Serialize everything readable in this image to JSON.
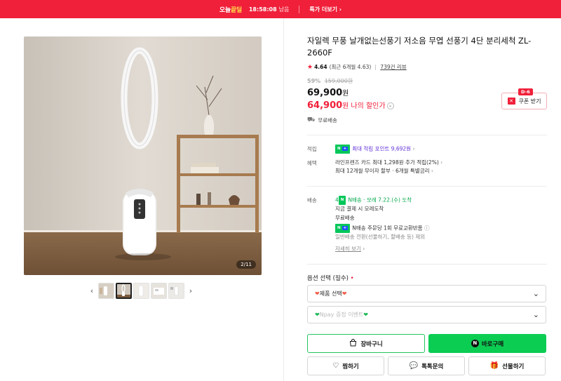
{
  "banner": {
    "brand_prefix": "오늘",
    "brand_suffix": "끝딜",
    "time": "18:58:08",
    "remain": "남음",
    "more": "특가 더보기"
  },
  "gallery": {
    "counter": "2/11",
    "thumb_count": 5,
    "active_thumb": 2
  },
  "product": {
    "title": "자일렉 무풍 날개없는선풍기 저소음 무엽 선풍기 4단 분리세척 ZL-2660F",
    "rating": "4.64",
    "rating_recent": "(최근 6개월 4.63",
    "reviews": "739건 리뷰",
    "discount_pct": "59%",
    "original_price": "159,000원",
    "price": "69,900",
    "price_unit": "원",
    "my_price": "64,900",
    "my_price_unit": "원",
    "my_price_label": "나의 할인가",
    "coupon_badge": "D-6",
    "coupon_label": "쿠폰 받기",
    "free_shipping": "무료배송"
  },
  "benefits": {
    "point_label": "적립",
    "point_text": "최대 적립 포인트 9,692원",
    "benefit_label": "혜택",
    "benefit_line1": "라인프렌즈 카드 최대 1,298원 추가 적립(2%)",
    "benefit_line2": "최대 12개월 무이자 할부 · 6개월 특별금리"
  },
  "delivery": {
    "label": "배송",
    "arrival_prefix": "4",
    "arrival": "N배송 · 모레 7.22.(수) 도착",
    "line2": "지금 결제 시 모레도착",
    "line3": "무료배송",
    "line4": "N배송 주문당 1회 무료교환반품",
    "line5": "일반배송 전환(선물하기, 할배송 등) 제외",
    "more": "자세히 보기"
  },
  "options": {
    "label": "옵션 선택 (필수)",
    "required_mark": "•",
    "select1": "제품 선택",
    "select2": "Npay 증정 이벤트"
  },
  "actions": {
    "cart": "장바구니",
    "buy": "바로구매",
    "wish": "찜하기",
    "talk": "톡톡문의",
    "gift": "선물하기"
  }
}
